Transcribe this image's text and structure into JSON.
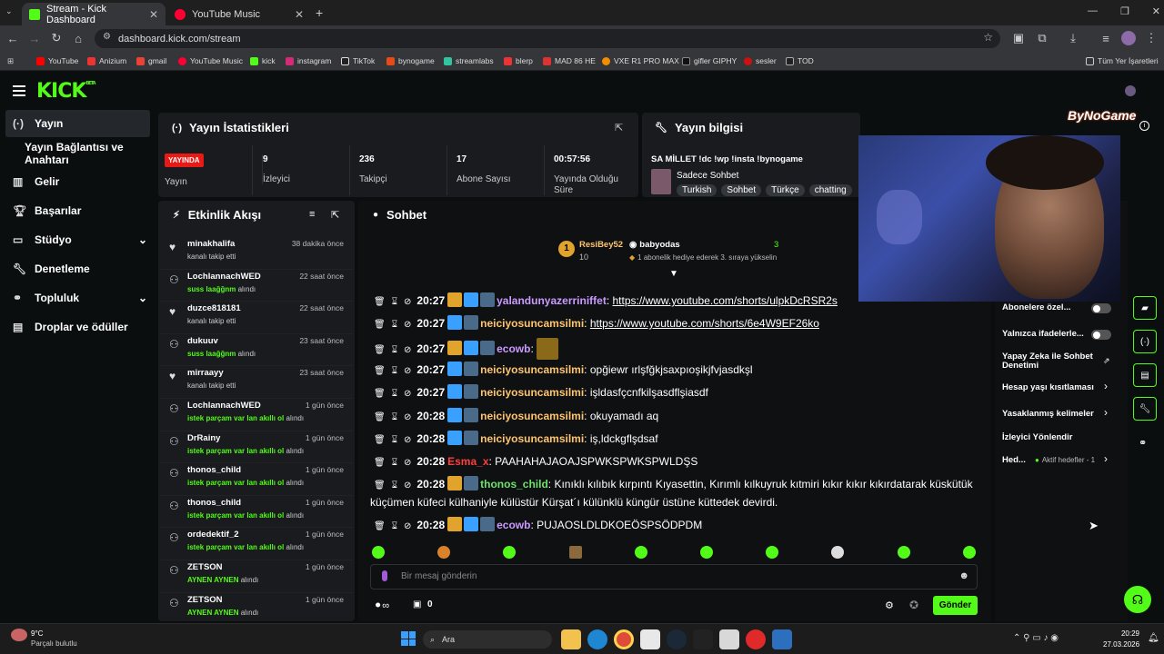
{
  "browser": {
    "tabs": [
      {
        "label": "Stream - Kick Dashboard",
        "active": true
      },
      {
        "label": "YouTube Music",
        "active": false
      }
    ],
    "url": "dashboard.kick.com/stream",
    "bookmarks": [
      "YouTube",
      "Anizium",
      "gmail",
      "YouTube Music",
      "kick",
      "instagram",
      "TikTok",
      "bynogame",
      "streamlabs",
      "blerp",
      "MAD 86 HE",
      "VXE R1 PRO MAX",
      "gifler GIPHY",
      "sesler",
      "TOD"
    ],
    "all_bookmarks": "Tüm Yer İşaretleri"
  },
  "kick": {
    "logo": "KICK",
    "logo_sup": "BETA",
    "sidebar": [
      {
        "label": "Yayın"
      },
      {
        "label": "Yayın Bağlantısı ve Anahtarı"
      },
      {
        "label": "Gelir"
      },
      {
        "label": "Başarılar"
      },
      {
        "label": "Stüdyo"
      },
      {
        "label": "Denetleme"
      },
      {
        "label": "Topluluk"
      },
      {
        "label": "Droplar ve ödüller"
      }
    ],
    "stats": {
      "title": "Yayın İstatistikleri",
      "live_badge": "YAYINDA",
      "live_label": "Yayın",
      "items": [
        {
          "value": "9",
          "label": "İzleyici"
        },
        {
          "value": "236",
          "label": "Takipçi"
        },
        {
          "value": "17",
          "label": "Abone Sayısı"
        },
        {
          "value": "00:57:56",
          "label": "Yayında Olduğu Süre"
        }
      ]
    },
    "info": {
      "title": "Yayın bilgisi",
      "stream_title": "SA MİLLET !dc !wp !insta !bynogame",
      "category": "Sadece Sohbet",
      "tags": [
        "Turkish",
        "Sohbet",
        "Türkçe",
        "chatting"
      ]
    },
    "activity": {
      "title": "Etkinlik Akışı",
      "items": [
        {
          "name": "minakhalifa",
          "sub": "kanalı takip etti",
          "bold": "",
          "tail": "",
          "time": "38 dakika önce"
        },
        {
          "name": "LochlannachWED",
          "sub": "",
          "bold": "suss laağğnm",
          "tail": " alındı",
          "time": "22 saat önce"
        },
        {
          "name": "duzce818181",
          "sub": "kanalı takip etti",
          "bold": "",
          "tail": "",
          "time": "22 saat önce"
        },
        {
          "name": "dukuuv",
          "sub": "",
          "bold": "suss laağğnm",
          "tail": " alındı",
          "time": "23 saat önce"
        },
        {
          "name": "mirraayy",
          "sub": "kanalı takip etti",
          "bold": "",
          "tail": "",
          "time": "23 saat önce"
        },
        {
          "name": "LochlannachWED",
          "sub": "",
          "bold": "istek parçam var lan akıllı ol",
          "tail": " alındı",
          "time": "1 gün önce"
        },
        {
          "name": "DrRainy",
          "sub": "",
          "bold": "istek parçam var lan akıllı ol",
          "tail": " alındı",
          "time": "1 gün önce"
        },
        {
          "name": "thonos_child",
          "sub": "",
          "bold": "istek parçam var lan akıllı ol",
          "tail": " alındı",
          "time": "1 gün önce"
        },
        {
          "name": "thonos_child",
          "sub": "",
          "bold": "istek parçam var lan akıllı ol",
          "tail": " alındı",
          "time": "1 gün önce"
        },
        {
          "name": "ordedektif_2",
          "sub": "",
          "bold": "istek parçam var lan akıllı ol",
          "tail": " alındı",
          "time": "1 gün önce"
        },
        {
          "name": "ZETSON",
          "sub": "",
          "bold": "AYNEN AYNEN",
          "tail": " alındı",
          "time": "1 gün önce"
        },
        {
          "name": "ZETSON",
          "sub": "",
          "bold": "AYNEN AYNEN",
          "tail": " alındı",
          "time": "1 gün önce"
        }
      ]
    },
    "chat": {
      "title": "Sohbet",
      "pinned": {
        "rank": "1",
        "user1": "ResiBey52",
        "count1": "10",
        "user2": "babyodas",
        "count2": "3",
        "note": "1 abonelik hediye ederek 3. sıraya yükselin"
      },
      "messages": [
        {
          "time": "20:27",
          "user": "yalandunyazerriniffet",
          "color": "purple",
          "text": "https://www.youtube.com/shorts/ulpkDcRSR2s",
          "link": true
        },
        {
          "time": "20:27",
          "user": "neiciyosuncamsilmi",
          "color": "yellow",
          "text": "https://www.youtube.com/shorts/6e4W9EF26ko",
          "link": true
        },
        {
          "time": "20:27",
          "user": "ecowb",
          "color": "purple",
          "text": "",
          "link": false
        },
        {
          "time": "20:27",
          "user": "neiciyosuncamsilmi",
          "color": "yellow",
          "text": "opğiewr ırlşfğkjsaxpıoşikjfvjasdkşl",
          "link": false
        },
        {
          "time": "20:27",
          "user": "neiciyosuncamsilmi",
          "color": "yellow",
          "text": "işldasfçcnfkilşasdflşiasdf",
          "link": false
        },
        {
          "time": "20:28",
          "user": "neiciyosuncamsilmi",
          "color": "yellow",
          "text": "okuyamadı aq",
          "link": false
        },
        {
          "time": "20:28",
          "user": "neiciyosuncamsilmi",
          "color": "yellow",
          "text": "iş,ldckgflşdsaf",
          "link": false
        },
        {
          "time": "20:28",
          "user": "Esma_x",
          "color": "red",
          "text": "PAAHAHAJAOAJSPWKSPWKSPWLDŞS",
          "link": false
        },
        {
          "time": "20:28",
          "user": "thonos_child",
          "color": "green",
          "text": "Kınıklı kılıbık kırpıntı Kıyasettin, Kırımlı kılkuyruk kıtmiri kıkır kıkır kıkırdatarak küskütük küçümen küfeci külhaniyle külüstür Kürşat´ı külünklü küngür üstüne küttedek devirdi.",
          "link": false
        },
        {
          "time": "20:28",
          "user": "ecowb",
          "color": "purple",
          "text": "PUJAOSLDLDKOEÖSPSÖDPDM",
          "link": false
        }
      ],
      "input_placeholder": "Bir mesaj gönderin",
      "points": "0",
      "send": "Gönder"
    },
    "settings": [
      {
        "label": "Abonelere özel..."
      },
      {
        "label": "Yalnızca ifadelerle..."
      },
      {
        "label": "Yapay Zeka ile Sohbet Denetimi"
      },
      {
        "label": "Hesap yaşı kısıtlaması"
      },
      {
        "label": "Yasaklanmış kelimeler"
      },
      {
        "label": "İzleyici Yönlendir"
      },
      {
        "label": "Hed..."
      }
    ],
    "goals": "Aktif hedefler - 1",
    "watermark": "ByNoGame"
  },
  "taskbar": {
    "weather_temp": "9°C",
    "weather_desc": "Parçalı bulutlu",
    "search": "Ara",
    "time": "20:29",
    "date": "27.03.2026"
  },
  "colors": {
    "accent": "#53fc18",
    "panel": "#191b1f",
    "bg": "#0b0e0f"
  }
}
